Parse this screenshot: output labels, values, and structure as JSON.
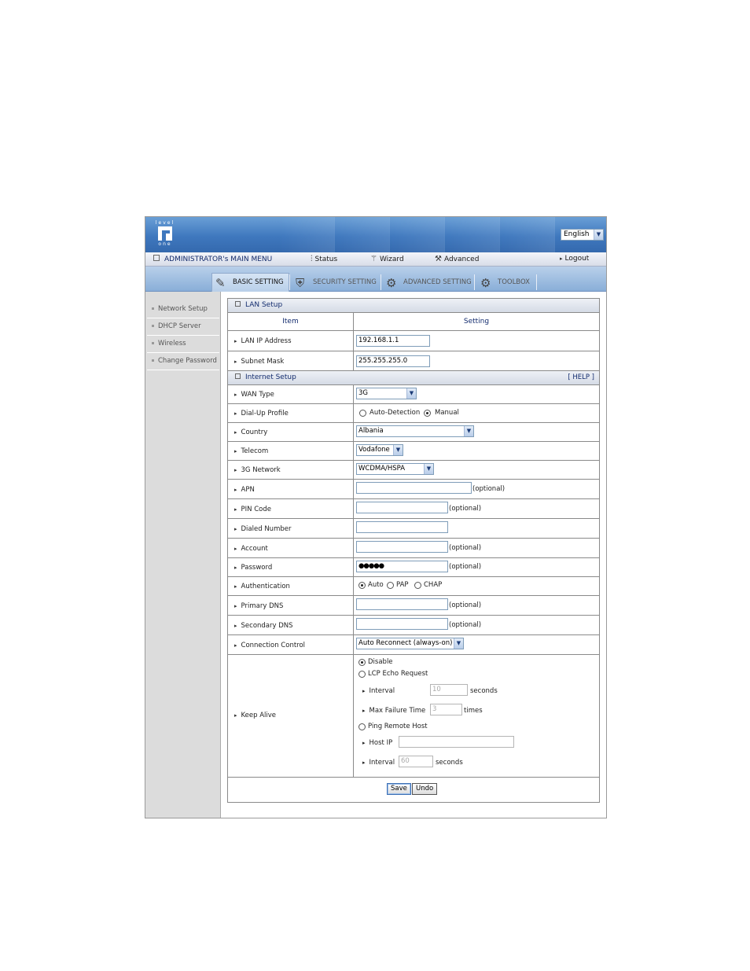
{
  "header": {
    "brand_top": "level",
    "brand_bottom": "one",
    "language": "English"
  },
  "menu": {
    "title": "ADMINISTRATOR's MAIN MENU",
    "status": "Status",
    "wizard": "Wizard",
    "advanced": "Advanced",
    "logout": "Logout"
  },
  "tabs": [
    "BASIC SETTING",
    "SECURITY SETTING",
    "ADVANCED SETTING",
    "TOOLBOX"
  ],
  "sidebar": [
    "Network Setup",
    "DHCP Server",
    "Wireless",
    "Change Password"
  ],
  "lan": {
    "section": "LAN Setup",
    "col_item": "Item",
    "col_setting": "Setting",
    "ip_label": "LAN IP Address",
    "ip_value": "192.168.1.1",
    "mask_label": "Subnet Mask",
    "mask_value": "255.255.255.0"
  },
  "internet": {
    "section": "Internet Setup",
    "help": "[ HELP ]",
    "wan_type_label": "WAN Type",
    "wan_type_value": "3G",
    "dialup_label": "Dial-Up Profile",
    "dialup_auto": "Auto-Detection",
    "dialup_manual": "Manual",
    "country_label": "Country",
    "country_value": "Albania",
    "telecom_label": "Telecom",
    "telecom_value": "Vodafone",
    "network_label": "3G Network",
    "network_value": "WCDMA/HSPA",
    "apn_label": "APN",
    "apn_value": "",
    "optional": "(optional)",
    "pin_label": "PIN Code",
    "pin_value": "",
    "dialed_label": "Dialed Number",
    "dialed_value": "",
    "account_label": "Account",
    "account_value": "",
    "password_label": "Password",
    "password_value": "●●●●●",
    "auth_label": "Authentication",
    "auth_auto": "Auto",
    "auth_pap": "PAP",
    "auth_chap": "CHAP",
    "pdns_label": "Primary DNS",
    "pdns_value": "",
    "sdns_label": "Secondary DNS",
    "sdns_value": "",
    "conn_label": "Connection Control",
    "conn_value": "Auto Reconnect (always-on)",
    "keepalive_label": "Keep Alive",
    "ka_disable": "Disable",
    "ka_lcp": "LCP Echo Request",
    "ka_interval_label": "Interval",
    "ka_interval_value": "10",
    "ka_seconds": "seconds",
    "ka_maxfail_label": "Max Failure Time",
    "ka_maxfail_value": "3",
    "ka_times": "times",
    "ka_ping": "Ping Remote Host",
    "ka_hostip_label": "Host IP",
    "ka_hostip_value": "",
    "ka_ping_interval_label": "Interval",
    "ka_ping_interval_value": "60",
    "ka_ping_seconds": "seconds"
  },
  "buttons": {
    "save": "Save",
    "undo": "Undo"
  }
}
